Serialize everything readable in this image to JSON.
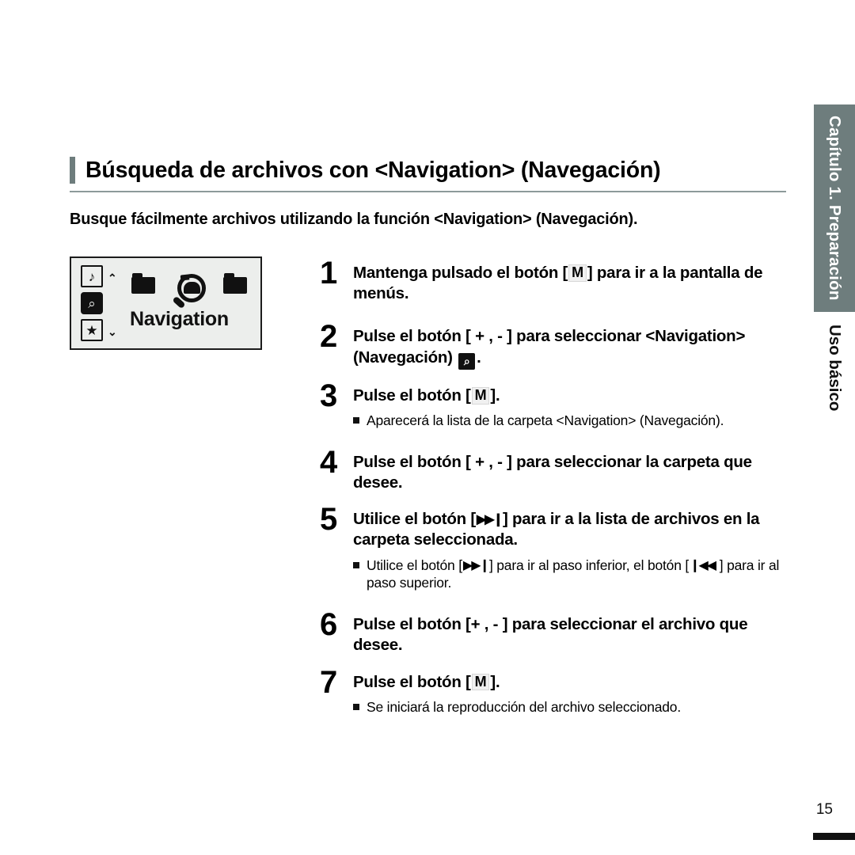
{
  "document": {
    "title": "Búsqueda de archivos con <Navigation> (Navegación)",
    "subtitle": "Busque fácilmente archivos utilizando la función <Navigation> (Navegación).",
    "page_number": "15"
  },
  "side_tab": {
    "chapter_label": "Capítulo 1. Preparación",
    "section_label": "Uso básico",
    "block_color": "#6e7d7d",
    "block_text_color": "#ffffff",
    "section_text_color": "#111111"
  },
  "accent_color": "#6e7d7d",
  "lcd_screen": {
    "menu_label": "Navigation",
    "left_icons": [
      {
        "name": "music-note-icon",
        "glyph": "♪",
        "selected": false
      },
      {
        "name": "magnifier-icon",
        "glyph": "⌕",
        "selected": true
      },
      {
        "name": "star-icon",
        "glyph": "★",
        "selected": false
      }
    ],
    "scroll_up": "⌃",
    "scroll_down": "⌄",
    "background": "#eceeec",
    "border": "#1c1c1c"
  },
  "steps": [
    {
      "number": "1",
      "text_before": "Mantenga pulsado el botón [",
      "key": "M",
      "text_after": "] para ir a la pantalla de menús.",
      "notes": []
    },
    {
      "number": "2",
      "text_before": "Pulse el botón [ + , - ] para seleccionar <Navigation> (Navegación) ",
      "key": "⌕",
      "text_after": ".",
      "notes": []
    },
    {
      "number": "3",
      "text_before": "Pulse el botón [",
      "key": "M",
      "text_after": "].",
      "notes": [
        "Aparecerá la lista de la carpeta <Navigation> (Navegación)."
      ]
    },
    {
      "number": "4",
      "text_before": "Pulse el botón [ + , - ] para seleccionar la carpeta que desee.",
      "key": "",
      "text_after": "",
      "notes": []
    },
    {
      "number": "5",
      "text_before": "Utilice el botón [",
      "key": "▶▶❙",
      "text_after": "] para ir a la lista de archivos en la carpeta seleccionada.",
      "notes": [
        "Utilice el botón [▶▶❙] para ir al paso inferior, el botón [❙◀◀ ] para ir al paso superior."
      ]
    },
    {
      "number": "6",
      "text_before": "Pulse el botón [+ , - ] para seleccionar el archivo que desee.",
      "key": "",
      "text_after": "",
      "notes": []
    },
    {
      "number": "7",
      "text_before": "Pulse el botón [",
      "key": "M",
      "text_after": "].",
      "notes": [
        "Se iniciará la reproducción del archivo seleccionado."
      ]
    }
  ],
  "step_notes": {
    "note_3_1": "Aparecerá la lista de la carpeta <Navigation> (Navegación).",
    "note_5_1_a": "Utilice el botón [",
    "note_5_1_next": "▶▶❙",
    "note_5_1_b": "] para ir al paso inferior, el botón [",
    "note_5_1_prev": "❙◀◀",
    "note_5_1_c": " ] para ir al paso superior.",
    "note_7_1": "Se iniciará la reproducción del archivo seleccionado."
  },
  "step_text_parts": {
    "s1_a": "Mantenga pulsado el botón [",
    "s1_key": "M",
    "s1_b": "] para ir a la pantalla de menús.",
    "s2_a": "Pulse el botón [ + , - ] para seleccionar <Navigation> (Navegación) ",
    "s2_key": "⌕",
    "s2_b": ".",
    "s3_a": "Pulse el botón [",
    "s3_key": "M",
    "s3_b": "].",
    "s4_a": "Pulse el botón [ + , - ] para seleccionar la carpeta que desee.",
    "s5_a": "Utilice el botón [",
    "s5_key": "▶▶❙",
    "s5_b": "] para ir a la lista de archivos en la carpeta seleccionada.",
    "s6_a": "Pulse el botón [+ , - ] para seleccionar el archivo que desee.",
    "s7_a": "Pulse el botón [",
    "s7_key": "M",
    "s7_b": "]."
  }
}
